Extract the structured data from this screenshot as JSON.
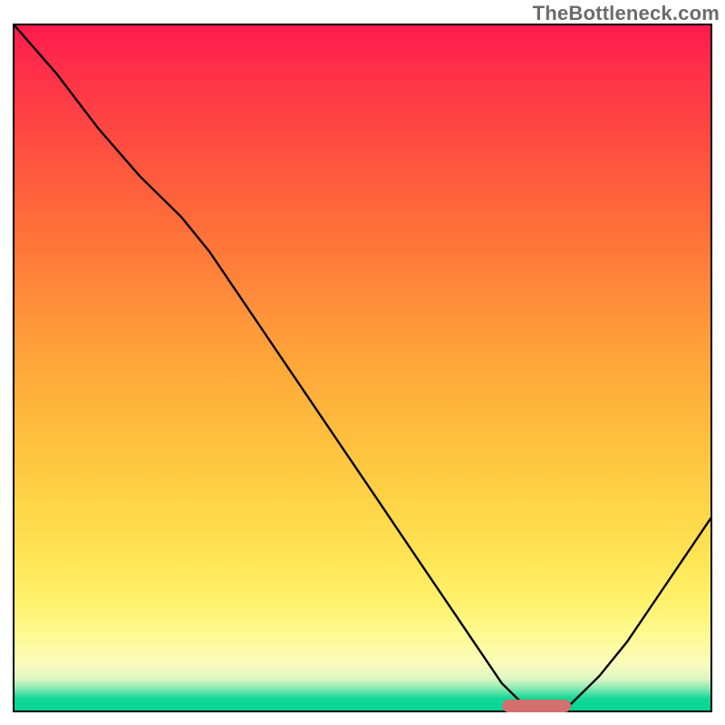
{
  "watermark": "TheBottleneck.com",
  "colors": {
    "top": "#ff1a4d",
    "bottom": "#06d494",
    "curve": "#000000",
    "marker": "#d36f6f",
    "frame": "#000000"
  },
  "chart_data": {
    "type": "line",
    "title": "",
    "xlabel": "",
    "ylabel": "",
    "xlim": [
      0,
      100
    ],
    "ylim": [
      0,
      100
    ],
    "grid": false,
    "legend": false,
    "series": [
      {
        "name": "bottleneck-curve",
        "x": [
          0,
          6,
          12,
          18,
          24,
          28,
          34,
          40,
          46,
          52,
          58,
          64,
          70,
          73,
          76,
          80,
          84,
          88,
          92,
          96,
          100
        ],
        "y": [
          100,
          93,
          85,
          78,
          72,
          67,
          58,
          49,
          40,
          31,
          22,
          13,
          4,
          1,
          0.5,
          1,
          5,
          10,
          16,
          22,
          28
        ]
      }
    ],
    "marker": {
      "x_start": 70,
      "x_end": 80,
      "y": 0.7
    },
    "axes_visible": false
  }
}
